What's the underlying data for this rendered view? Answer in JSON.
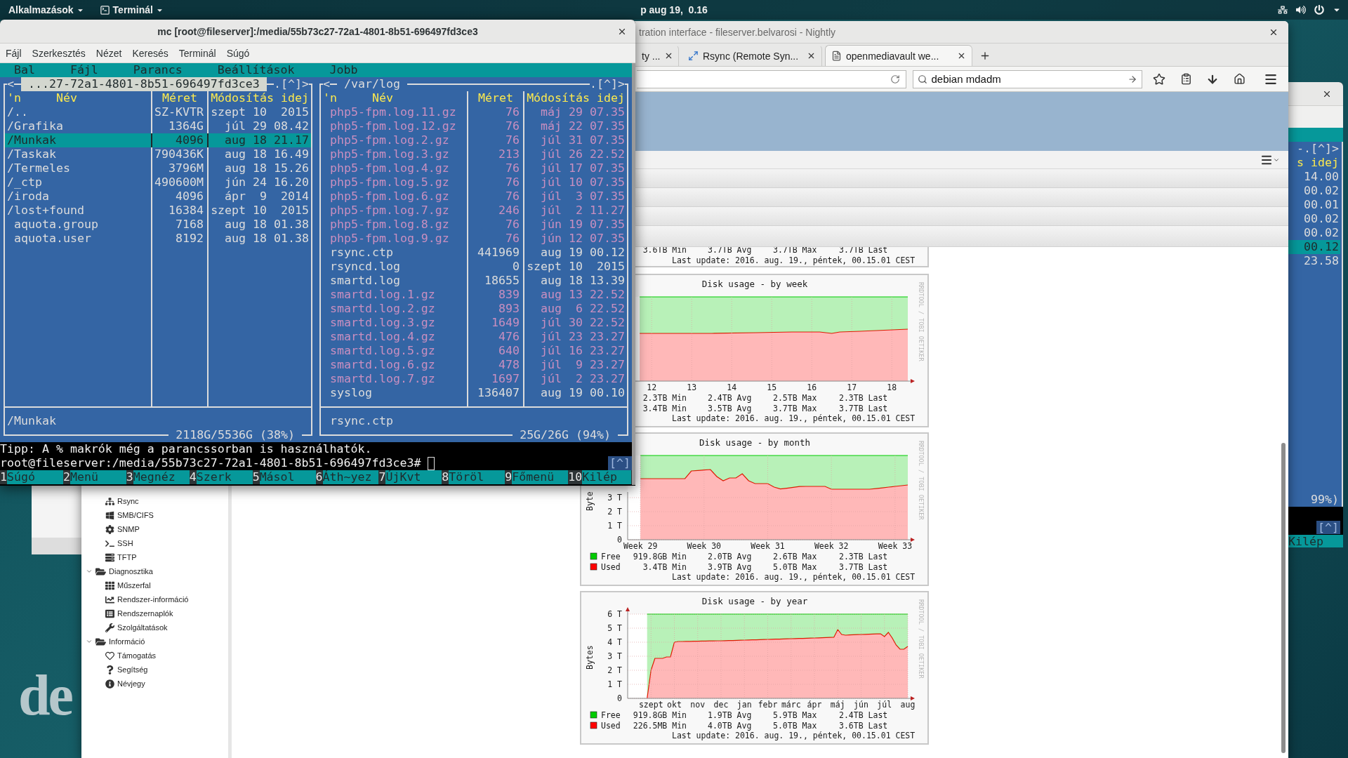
{
  "top_bar": {
    "apps_menu": "Alkalmazások",
    "app_menu": "Terminál",
    "clock": "p aug 19,  0.16"
  },
  "wallpaper_logo": "de",
  "terminal_window": {
    "title": "mc [root@fileserver]:/media/55b73c27-72a1-4801-8b51-696497fd3ce3",
    "menu": [
      "Fájl",
      "Szerkesztés",
      "Nézet",
      "Keresés",
      "Terminál",
      "Súgó"
    ],
    "mc": {
      "menu": [
        "Bal",
        "Fájl",
        "Parancs",
        "Beállítások",
        "Jobb"
      ],
      "panels": [
        {
          "active": true,
          "title": "...27-72a1-4801-8b51-696497fd3ce3",
          "nav_left": "<",
          "nav_right": ".[^]>",
          "columns": [
            "'n",
            "Név",
            "Méret",
            "Módosítás idej"
          ],
          "status": "/Munkak",
          "usage": "2118G/5536G (38%)",
          "rows": [
            {
              "name": "/..",
              "size": "SZ-KVTR",
              "date": "szept 10  2015",
              "kind": "dir",
              "selected": false
            },
            {
              "name": "/Grafika",
              "size": "1364G",
              "date": "júl 29 08.42",
              "kind": "dir",
              "selected": false
            },
            {
              "name": "/Munkak",
              "size": "4096",
              "date": "aug 18 21.17",
              "kind": "dir",
              "selected": true
            },
            {
              "name": "/Taskak",
              "size": "790436K",
              "date": "aug 18 16.49",
              "kind": "dir",
              "selected": false
            },
            {
              "name": "/Termeles",
              "size": "3796M",
              "date": "aug 18 15.26",
              "kind": "dir",
              "selected": false
            },
            {
              "name": "/_ctp",
              "size": "490600M",
              "date": "jún 24 16.20",
              "kind": "dir",
              "selected": false
            },
            {
              "name": "/iroda",
              "size": "4096",
              "date": "ápr  9  2014",
              "kind": "dir",
              "selected": false
            },
            {
              "name": "/lost+found",
              "size": "16384",
              "date": "szept 10  2015",
              "kind": "dir",
              "selected": false
            },
            {
              "name": "aquota.group",
              "size": "7168",
              "date": "aug 18 01.38",
              "kind": "file",
              "selected": false
            },
            {
              "name": "aquota.user",
              "size": "8192",
              "date": "aug 18 01.38",
              "kind": "file",
              "selected": false
            }
          ]
        },
        {
          "active": false,
          "title": "/var/log",
          "nav_left": "<",
          "nav_right": ".[^]>",
          "columns": [
            "'n",
            "Név",
            "Méret",
            "Módosítás idej"
          ],
          "status": "rsync.ctp",
          "usage": "25G/26G (94%)",
          "rows": [
            {
              "name": "php5-fpm.log.11.gz",
              "size": "76",
              "date": "máj 29 07.35",
              "kind": "archive",
              "selected": false
            },
            {
              "name": "php5-fpm.log.12.gz",
              "size": "76",
              "date": "máj 22 07.35",
              "kind": "archive",
              "selected": false
            },
            {
              "name": "php5-fpm.log.2.gz",
              "size": "76",
              "date": "júl 31 07.35",
              "kind": "archive",
              "selected": false
            },
            {
              "name": "php5-fpm.log.3.gz",
              "size": "213",
              "date": "júl 26 22.52",
              "kind": "archive",
              "selected": false
            },
            {
              "name": "php5-fpm.log.4.gz",
              "size": "76",
              "date": "júl 17 07.35",
              "kind": "archive",
              "selected": false
            },
            {
              "name": "php5-fpm.log.5.gz",
              "size": "76",
              "date": "júl 10 07.35",
              "kind": "archive",
              "selected": false
            },
            {
              "name": "php5-fpm.log.6.gz",
              "size": "76",
              "date": "júl  3 07.35",
              "kind": "archive",
              "selected": false
            },
            {
              "name": "php5-fpm.log.7.gz",
              "size": "246",
              "date": "júl  2 11.27",
              "kind": "archive",
              "selected": false
            },
            {
              "name": "php5-fpm.log.8.gz",
              "size": "76",
              "date": "jún 19 07.35",
              "kind": "archive",
              "selected": false
            },
            {
              "name": "php5-fpm.log.9.gz",
              "size": "76",
              "date": "jún 12 07.35",
              "kind": "archive",
              "selected": false
            },
            {
              "name": "rsync.ctp",
              "size": "441969",
              "date": "aug 19 00.12",
              "kind": "file",
              "selected": false
            },
            {
              "name": "rsyncd.log",
              "size": "0",
              "date": "szept 10  2015",
              "kind": "file",
              "selected": false
            },
            {
              "name": "smartd.log",
              "size": "18655",
              "date": "aug 18 13.39",
              "kind": "file",
              "selected": false
            },
            {
              "name": "smartd.log.1.gz",
              "size": "839",
              "date": "aug 13 22.52",
              "kind": "archive",
              "selected": false
            },
            {
              "name": "smartd.log.2.gz",
              "size": "893",
              "date": "aug  6 22.52",
              "kind": "archive",
              "selected": false
            },
            {
              "name": "smartd.log.3.gz",
              "size": "1649",
              "date": "júl 30 22.52",
              "kind": "archive",
              "selected": false
            },
            {
              "name": "smartd.log.4.gz",
              "size": "476",
              "date": "júl 23 23.27",
              "kind": "archive",
              "selected": false
            },
            {
              "name": "smartd.log.5.gz",
              "size": "640",
              "date": "júl 16 23.27",
              "kind": "archive",
              "selected": false
            },
            {
              "name": "smartd.log.6.gz",
              "size": "478",
              "date": "júl  9 23.27",
              "kind": "archive",
              "selected": false
            },
            {
              "name": "smartd.log.7.gz",
              "size": "1697",
              "date": "júl  2 23.27",
              "kind": "archive",
              "selected": false
            },
            {
              "name": "syslog",
              "size": "136407",
              "date": "aug 19 00.10",
              "kind": "file",
              "selected": false
            }
          ]
        }
      ],
      "hint": "Tipp: A % makrók még a parancssorban is használhatók.",
      "prompt": "root@fileserver:/media/55b73c27-72a1-4801-8b51-696497fd3ce3#",
      "prompt_badge": "[^]",
      "function_keys": [
        {
          "key": "1",
          "label": "Súgó"
        },
        {
          "key": "2",
          "label": "Menü"
        },
        {
          "key": "3",
          "label": "Megnéz"
        },
        {
          "key": "4",
          "label": "Szerk"
        },
        {
          "key": "5",
          "label": "Másol"
        },
        {
          "key": "6",
          "label": "Áth~yez"
        },
        {
          "key": "7",
          "label": "ÚjKvt"
        },
        {
          "key": "8",
          "label": "Töröl"
        },
        {
          "key": "9",
          "label": "Főmenü"
        },
        {
          "key": "10",
          "label": "Kilép"
        }
      ]
    }
  },
  "back_window": {
    "border_label": "-.[^]>",
    "column_header": "s idej",
    "times": [
      {
        "text": "14.00",
        "selected": false
      },
      {
        "text": "00.02",
        "selected": false
      },
      {
        "text": "00.01",
        "selected": false
      },
      {
        "text": "00.02",
        "selected": false
      },
      {
        "text": "00.02",
        "selected": false
      },
      {
        "text": "00.12",
        "selected": true
      },
      {
        "text": "23.58",
        "selected": false
      }
    ],
    "usage": "99%)",
    "badge": "[^]",
    "key_label": "Kilép"
  },
  "browser": {
    "title": "tration interface - fileserver.belvarosi - Nightly",
    "tabs": [
      {
        "label": "ty ...",
        "selected": false
      },
      {
        "label": "Rsync (Remote Syn...",
        "selected": false
      },
      {
        "label": "openmediavault we...",
        "selected": true
      }
    ],
    "search": {
      "value": "debian mdadm"
    },
    "sidebar": {
      "items": [
        "Rsync",
        "SMB/CIFS",
        "SNMP",
        "SSH",
        "TFTP"
      ],
      "groups": [
        {
          "label": "Diagnosztika",
          "expanded": true,
          "children": [
            {
              "label": "Műszerfal"
            },
            {
              "label": "Rendszer-információ"
            },
            {
              "label": "Rendszernaplók"
            },
            {
              "label": "Szolgáltatások"
            }
          ]
        },
        {
          "label": "Információ",
          "expanded": true,
          "children": [
            {
              "label": "Támogatás"
            },
            {
              "label": "Segítség"
            },
            {
              "label": "Névjegy"
            }
          ]
        }
      ]
    },
    "charts": [
      {
        "kind": "partial",
        "legend": [
          {
            "stats": [
              "3.6TB Min",
              "3.7TB Avg",
              "3.7TB Max",
              "3.7TB Last"
            ]
          }
        ],
        "last_update": "Last update: 2016. aug. 19., péntek, 00.15.01 CEST"
      },
      {
        "kind": "picture_graph",
        "credit": "RRDTOOL / TOBI OETIKER",
        "last_update": "Last update: 2016. aug. 19., péntek, 00.15.01 CEST",
        "legend": [
          {
            "stats": [
              "2.3TB Min",
              "2.4TB Avg",
              "2.5TB Max",
              "2.3TB Last"
            ]
          },
          {
            "stats": [
              "3.4TB Min",
              "3.5TB Avg",
              "3.7TB Max",
              "3.7TB Last"
            ]
          }
        ],
        "picture": {
          "title": "Disk usage - by week",
          "x_labels": [
            "12",
            "13",
            "14",
            "15",
            "16",
            "17",
            "18"
          ]
        }
      },
      {
        "kind": "graph",
        "credit": "RRDTOOL / TOBI OETIKER",
        "last_update": "Last update: 2016. aug. 19., péntek, 00.15.01 CEST",
        "legend": [
          {
            "label": "Free",
            "color": "#00cc00",
            "stats": [
              "919.8GB Min",
              "2.0TB Avg",
              "2.6TB Max",
              "2.3TB Last"
            ]
          },
          {
            "label": "Used",
            "color": "#ff0000",
            "stats": [
              "3.4TB Min",
              "3.9TB Avg",
              "5.0TB Max",
              "3.7TB Last"
            ]
          }
        ],
        "chart_data": {
          "type": "area",
          "title": "Disk usage - by month",
          "ylabel": "Byte",
          "stacked": true,
          "grid": true,
          "ylim": [
            0,
            6
          ],
          "categories": [
            null,
            null,
            "Week 29",
            null,
            null,
            null,
            null,
            null,
            null,
            null,
            null,
            null,
            "Week 30",
            null,
            null,
            null,
            null,
            null,
            null,
            null,
            null,
            null,
            "Week 31",
            null,
            null,
            null,
            null,
            null,
            null,
            null,
            null,
            null,
            "Week 32",
            null,
            null,
            null,
            null,
            null,
            null,
            null,
            null,
            null,
            "Week 33",
            null,
            null
          ],
          "series": [
            {
              "color": "#ff0000",
              "values": [
                null,
                null,
                4.35,
                4.35,
                4.35,
                4.35,
                4.35,
                4.35,
                4.35,
                4.35,
                4.9,
                4.93,
                4.97,
                5.0,
                4.5,
                4.2,
                4.4,
                4.4,
                4.7,
                4.2,
                4.0,
                4.0,
                4.0,
                3.75,
                3.62,
                3.67,
                3.73,
                3.79,
                3.8,
                3.8,
                3.8,
                3.8,
                3.6,
                3.6,
                3.6,
                3.6,
                3.6,
                3.6,
                3.6,
                3.64,
                3.69,
                3.75,
                3.8,
                3.85,
                3.9
              ]
            },
            {
              "color": "#00cc00",
              "values": [
                null,
                null,
                1.65,
                1.65,
                1.65,
                1.65,
                1.65,
                1.65,
                1.65,
                1.65,
                1.1,
                1.07,
                1.03,
                1.0,
                1.5,
                1.8,
                1.6,
                1.6,
                1.3,
                1.8,
                2.0,
                2.0,
                2.0,
                2.25,
                2.38,
                2.33,
                2.27,
                2.21,
                2.2,
                2.2,
                2.2,
                2.2,
                2.4,
                2.4,
                2.4,
                2.4,
                2.4,
                2.4,
                2.4,
                2.36,
                2.31,
                2.25,
                2.2,
                2.15,
                2.1
              ]
            }
          ],
          "yticks": [
            {
              "value": 0,
              "label": "0"
            },
            {
              "value": 1,
              "label": "1 T"
            },
            {
              "value": 2,
              "label": "2 T"
            },
            {
              "value": 3,
              "label": "3 T"
            }
          ]
        }
      },
      {
        "kind": "graph",
        "credit": "RRDTOOL / TOBI OETIKER",
        "last_update": "Last update: 2016. aug. 19., péntek, 00.15.01 CEST",
        "legend": [
          {
            "label": "Free",
            "color": "#00cc00",
            "stats": [
              "919.8GB Min",
              "1.9TB Avg",
              "5.9TB Max",
              "2.4TB Last"
            ]
          },
          {
            "label": "Used",
            "color": "#ff0000",
            "stats": [
              "226.5MB Min",
              "4.0TB Avg",
              "5.0TB Max",
              "3.6TB Last"
            ]
          }
        ],
        "chart_data": {
          "type": "area",
          "title": "Disk usage - by year",
          "ylabel": "Bytes",
          "stacked": true,
          "grid": true,
          "ylim": [
            0,
            6
          ],
          "categories": [
            null,
            null,
            null,
            null,
            null,
            null,
            "szept",
            null,
            null,
            null,
            null,
            null,
            "okt",
            null,
            null,
            null,
            null,
            null,
            "nov",
            null,
            null,
            null,
            null,
            null,
            "dec",
            null,
            null,
            null,
            null,
            null,
            "jan",
            null,
            null,
            null,
            null,
            null,
            "febr",
            null,
            null,
            null,
            null,
            null,
            "márc",
            null,
            null,
            null,
            null,
            null,
            "ápr",
            null,
            null,
            null,
            null,
            null,
            "máj",
            null,
            null,
            null,
            null,
            null,
            "jún",
            null,
            null,
            null,
            null,
            null,
            "júl",
            null,
            null,
            null,
            null,
            null,
            "aug"
          ],
          "series": [
            {
              "color": "#ff0000",
              "values": [
                null,
                null,
                null,
                null,
                null,
                0,
                2.0,
                2.85,
                2.85,
                2.85,
                2.95,
                2.95,
                4.0,
                4.05,
                4.05,
                4.06,
                4.06,
                4.07,
                4.07,
                4.08,
                4.08,
                4.09,
                4.09,
                4.1,
                4.1,
                4.11,
                4.12,
                4.12,
                4.13,
                4.14,
                4.15,
                4.16,
                4.17,
                4.17,
                4.18,
                4.19,
                4.2,
                4.21,
                4.22,
                4.22,
                4.23,
                4.24,
                4.25,
                4.26,
                4.27,
                4.27,
                4.28,
                4.29,
                4.3,
                4.31,
                4.32,
                4.33,
                4.34,
                4.35,
                4.9,
                4.55,
                4.5,
                4.52,
                4.53,
                4.54,
                4.55,
                4.56,
                4.57,
                4.58,
                4.59,
                4.6,
                4.4,
                4.7,
                4.3,
                3.8,
                3.5,
                3.5,
                3.7
              ]
            },
            {
              "color": "#00cc00",
              "values": [
                null,
                null,
                null,
                null,
                null,
                6,
                4.0,
                3.15,
                3.15,
                3.15,
                3.05,
                3.05,
                2.0,
                1.95,
                1.95,
                1.94,
                1.94,
                1.93,
                1.93,
                1.92,
                1.92,
                1.91,
                1.91,
                1.9,
                1.9,
                1.89,
                1.88,
                1.88,
                1.87,
                1.86,
                1.85,
                1.84,
                1.83,
                1.83,
                1.82,
                1.81,
                1.8,
                1.79,
                1.78,
                1.78,
                1.77,
                1.76,
                1.75,
                1.74,
                1.73,
                1.73,
                1.72,
                1.71,
                1.7,
                1.69,
                1.68,
                1.67,
                1.66,
                1.65,
                1.1,
                1.45,
                1.5,
                1.48,
                1.47,
                1.46,
                1.45,
                1.44,
                1.43,
                1.42,
                1.41,
                1.4,
                1.6,
                1.3,
                1.7,
                2.2,
                2.5,
                2.5,
                2.3
              ]
            }
          ],
          "yticks": [
            {
              "value": 0,
              "label": "0"
            },
            {
              "value": 1,
              "label": "1 T"
            },
            {
              "value": 2,
              "label": "2 T"
            },
            {
              "value": 3,
              "label": "3 T"
            },
            {
              "value": 4,
              "label": "4 T"
            },
            {
              "value": 5,
              "label": "5 T"
            },
            {
              "value": 6,
              "label": "6 T"
            }
          ]
        }
      }
    ]
  }
}
